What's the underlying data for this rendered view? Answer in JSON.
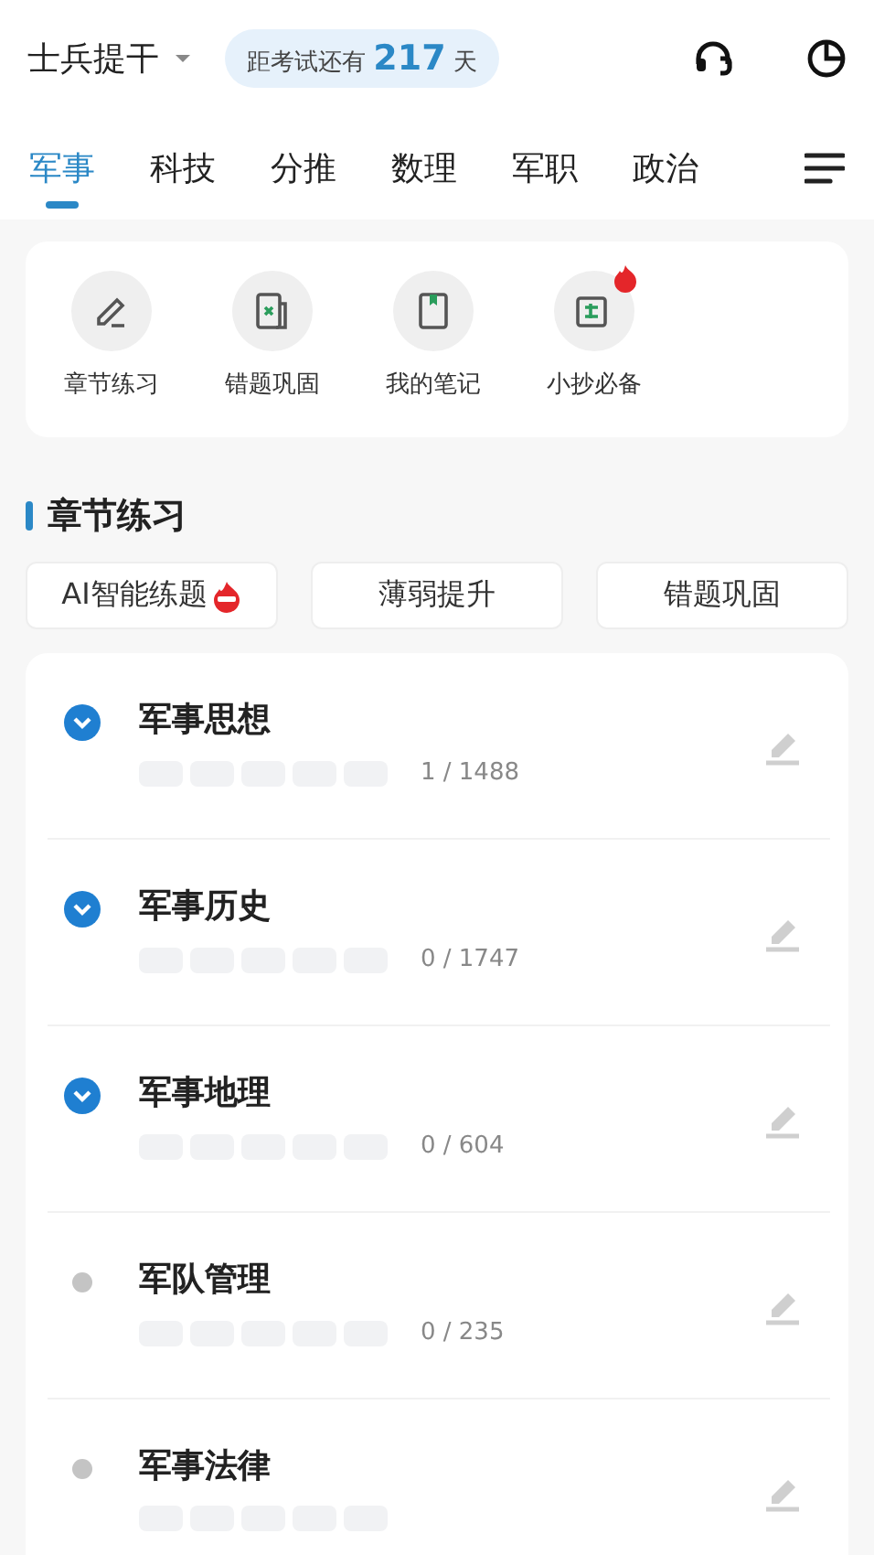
{
  "header": {
    "exam_type": "士兵提干",
    "countdown": {
      "prefix": "距考试还有",
      "days": "217",
      "suffix": "天"
    }
  },
  "tabs": [
    {
      "label": "军事",
      "selected": true
    },
    {
      "label": "科技",
      "selected": false
    },
    {
      "label": "分推",
      "selected": false
    },
    {
      "label": "数理",
      "selected": false
    },
    {
      "label": "军职",
      "selected": false
    },
    {
      "label": "政治",
      "selected": false
    }
  ],
  "shortcuts": [
    {
      "label": "章节练习",
      "kind": "pencil",
      "hot": false
    },
    {
      "label": "错题巩固",
      "kind": "wrong",
      "hot": false
    },
    {
      "label": "我的笔记",
      "kind": "notebook",
      "hot": false
    },
    {
      "label": "小抄必备",
      "kind": "cheat",
      "hot": true
    }
  ],
  "section_title": "章节练习",
  "practice_buttons": [
    {
      "label": "AI智能练题",
      "hot": true
    },
    {
      "label": "薄弱提升",
      "hot": false
    },
    {
      "label": "错题巩固",
      "hot": false
    }
  ],
  "chapters": [
    {
      "name": "军事思想",
      "kind": "group",
      "count": "1 / 1488"
    },
    {
      "name": "军事历史",
      "kind": "group",
      "count": "0 / 1747"
    },
    {
      "name": "军事地理",
      "kind": "group",
      "count": "0 / 604"
    },
    {
      "name": "军队管理",
      "kind": "leaf",
      "count": "0 / 235"
    },
    {
      "name": "军事法律",
      "kind": "leaf"
    }
  ]
}
